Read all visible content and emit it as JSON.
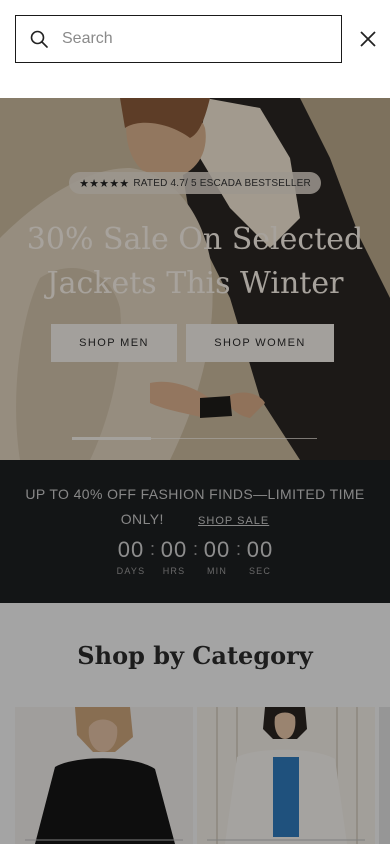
{
  "search": {
    "placeholder": "Search",
    "value": ""
  },
  "hero": {
    "rating_stars": "★★★★★",
    "rating_text": "RATED 4.7/ 5 ESCADA BESTSELLER",
    "title": "30% Sale On Selected Jackets This Winter",
    "button_men": "SHOP MEN",
    "button_women": "SHOP WOMEN"
  },
  "promo": {
    "text": "UP TO 40% OFF FASHION FINDS—LIMITED TIME ONLY!",
    "link": "SHOP SALE",
    "countdown": [
      {
        "value": "00",
        "label": "DAYS"
      },
      {
        "value": "00",
        "label": "HRS"
      },
      {
        "value": "00",
        "label": "MIN"
      },
      {
        "value": "00",
        "label": "SEC"
      }
    ],
    "separator": ":"
  },
  "category": {
    "title": "Shop by Category"
  }
}
